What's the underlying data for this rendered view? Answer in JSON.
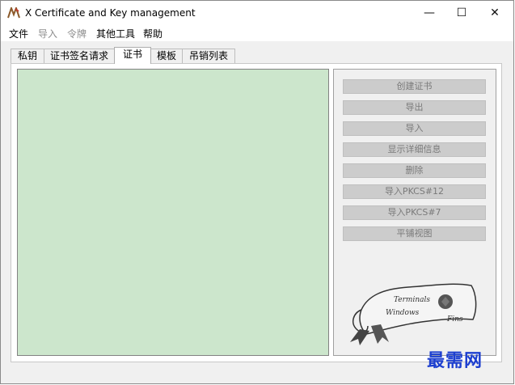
{
  "window": {
    "title": "X Certificate and Key management",
    "minimize_glyph": "—",
    "maximize_glyph": "☐",
    "close_glyph": "✕"
  },
  "menu": [
    {
      "label": "文件",
      "enabled": true
    },
    {
      "label": "导入",
      "enabled": false
    },
    {
      "label": "令牌",
      "enabled": false
    },
    {
      "label": "其他工具",
      "enabled": true
    },
    {
      "label": "帮助",
      "enabled": true
    }
  ],
  "tabs": [
    {
      "label": "私钥",
      "active": false
    },
    {
      "label": "证书签名请求",
      "active": false
    },
    {
      "label": "证书",
      "active": true
    },
    {
      "label": "模板",
      "active": false
    },
    {
      "label": "吊销列表",
      "active": false
    }
  ],
  "actions": [
    {
      "label": "创建证书"
    },
    {
      "label": "导出"
    },
    {
      "label": "导入"
    },
    {
      "label": "显示详细信息"
    },
    {
      "label": "删除"
    },
    {
      "label": "导入PKCS#12"
    },
    {
      "label": "导入PKCS#7"
    },
    {
      "label": "平铺视图"
    }
  ],
  "logo": {
    "line1": "Terminals",
    "line2": "Windows",
    "line3": "Fins"
  },
  "watermark": "最需网",
  "colors": {
    "list_background": "#cce6cc",
    "disabled_button": "#cccccc",
    "watermark": "#1d3fcf"
  }
}
